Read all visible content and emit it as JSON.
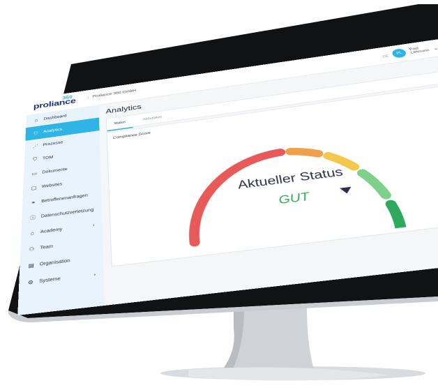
{
  "brand": {
    "logo": "proliance",
    "logo_number": "360",
    "company": "Proliance 360 GmbH"
  },
  "header": {
    "language": "DE",
    "avatar_initials": "PL",
    "user_name_line1": "Paul",
    "user_name_line2": "Lehmann"
  },
  "sidebar": {
    "items": [
      {
        "label": "Dashboard",
        "icon": "home-icon"
      },
      {
        "label": "Analytics",
        "icon": "analytics-icon",
        "active": true
      },
      {
        "label": "Prozesse",
        "icon": "process-icon"
      },
      {
        "label": "TOM",
        "icon": "shield-icon"
      },
      {
        "label": "Dokumente",
        "icon": "folder-icon"
      },
      {
        "label": "Websites",
        "icon": "window-icon"
      },
      {
        "label": "Betroffenenanfragen",
        "icon": "people-icon"
      },
      {
        "label": "Datenschutzverletzung",
        "icon": "alert-icon"
      },
      {
        "label": "Academy",
        "icon": "graduation-icon",
        "has_arrow": true
      },
      {
        "label": "Team",
        "icon": "team-icon"
      },
      {
        "label": "Organisation",
        "icon": "building-icon"
      },
      {
        "label": "Systeme",
        "icon": "gears-icon",
        "has_arrow": true
      }
    ]
  },
  "main": {
    "title": "Analytics",
    "tabs": [
      {
        "label": "Status",
        "active": true
      },
      {
        "label": "Aktivitäten"
      }
    ],
    "card_title": "Compliance Score",
    "gauge": {
      "status_label": "Aktueller Status",
      "status_value": "GUT",
      "colors": {
        "red": "#e85a5a",
        "orange": "#f0a04b",
        "yellow": "#f2c94c",
        "light_green": "#7fd08a",
        "green": "#2eaa5c",
        "marker": "#2a3047"
      }
    }
  },
  "colors": {
    "accent": "#2fb4e6",
    "sidebar_bg": "#e8f3fb"
  }
}
